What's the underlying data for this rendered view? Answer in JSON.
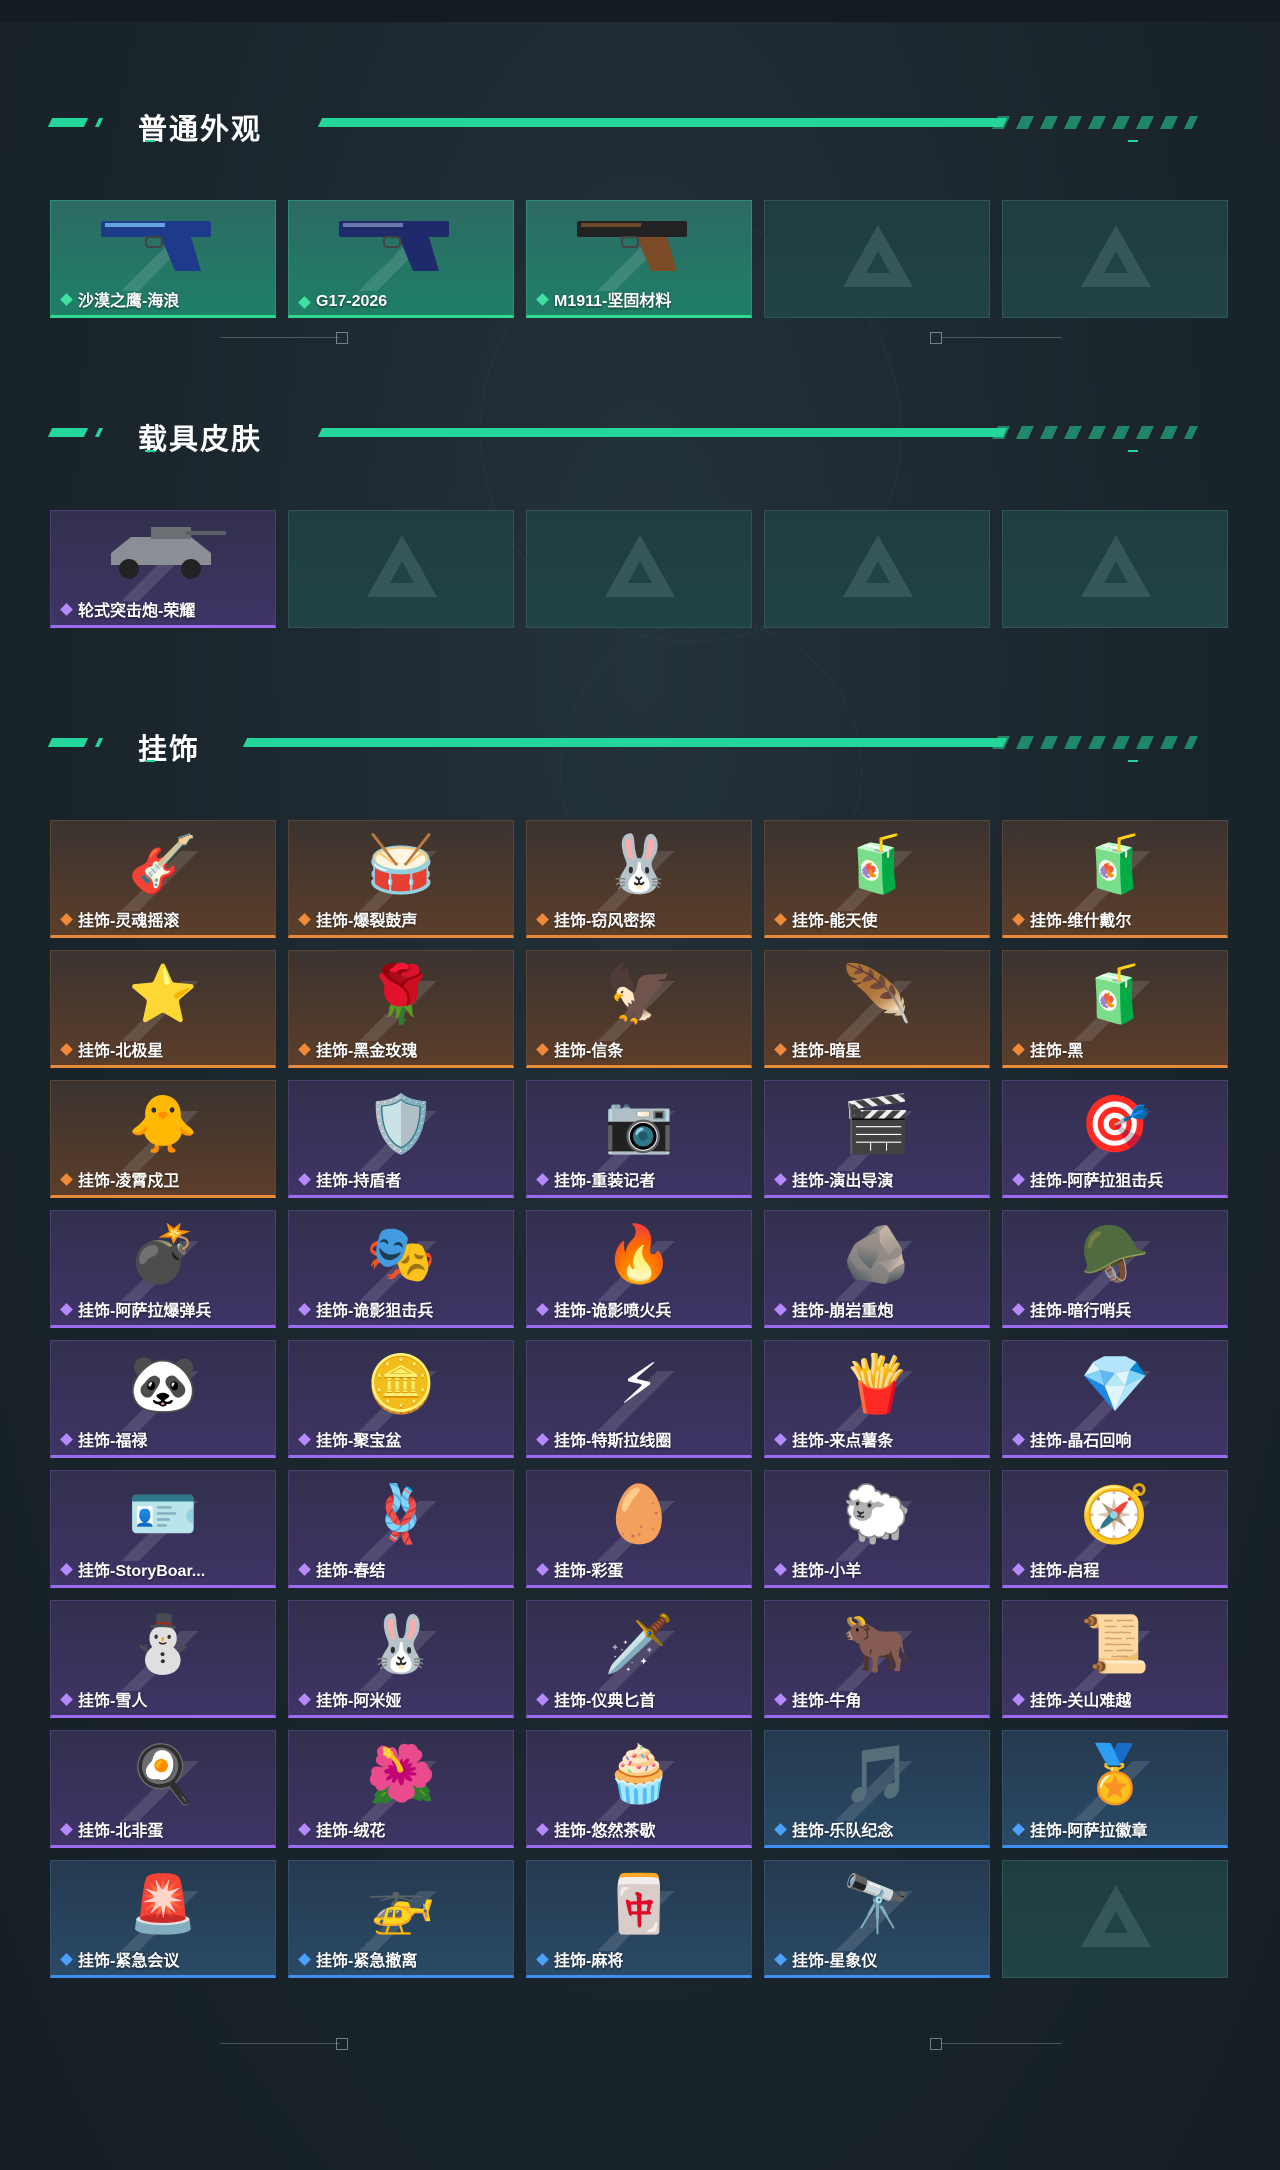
{
  "sections": [
    {
      "title": "普通外观",
      "items": [
        {
          "label": "沙漠之鹰-海浪",
          "rarity": "green",
          "icon": "pistol-icon"
        },
        {
          "label": "G17-2026",
          "rarity": "green",
          "icon": "pistol-icon"
        },
        {
          "label": "M1911-坚固材料",
          "rarity": "green",
          "icon": "pistol-icon"
        },
        {
          "label": "",
          "rarity": "empty"
        },
        {
          "label": "",
          "rarity": "empty"
        }
      ]
    },
    {
      "title": "载具皮肤",
      "items": [
        {
          "label": "轮式突击炮-荣耀",
          "rarity": "purple",
          "icon": "vehicle-icon"
        },
        {
          "label": "",
          "rarity": "empty"
        },
        {
          "label": "",
          "rarity": "empty"
        },
        {
          "label": "",
          "rarity": "empty"
        },
        {
          "label": "",
          "rarity": "empty"
        }
      ]
    },
    {
      "title": "挂饰",
      "items": [
        {
          "label": "挂饰-灵魂摇滚",
          "rarity": "orange",
          "icon": "🎸"
        },
        {
          "label": "挂饰-爆裂鼓声",
          "rarity": "orange",
          "icon": "🥁"
        },
        {
          "label": "挂饰-窃风密探",
          "rarity": "orange",
          "icon": "🐰"
        },
        {
          "label": "挂饰-能天使",
          "rarity": "orange",
          "icon": "🧃"
        },
        {
          "label": "挂饰-维什戴尔",
          "rarity": "orange",
          "icon": "🧃"
        },
        {
          "label": "挂饰-北极星",
          "rarity": "orange",
          "icon": "⭐"
        },
        {
          "label": "挂饰-黑金玫瑰",
          "rarity": "orange",
          "icon": "🌹"
        },
        {
          "label": "挂饰-信条",
          "rarity": "orange",
          "icon": "🦅"
        },
        {
          "label": "挂饰-暗星",
          "rarity": "orange",
          "icon": "🪶"
        },
        {
          "label": "挂饰-黑",
          "rarity": "orange",
          "icon": "🧃"
        },
        {
          "label": "挂饰-凌霄戍卫",
          "rarity": "orange",
          "icon": "🐥"
        },
        {
          "label": "挂饰-持盾者",
          "rarity": "purple",
          "icon": "🛡️"
        },
        {
          "label": "挂饰-重装记者",
          "rarity": "purple",
          "icon": "📷"
        },
        {
          "label": "挂饰-演出导演",
          "rarity": "purple",
          "icon": "🎬"
        },
        {
          "label": "挂饰-阿萨拉狙击兵",
          "rarity": "purple",
          "icon": "🎯"
        },
        {
          "label": "挂饰-阿萨拉爆弹兵",
          "rarity": "purple",
          "icon": "💣"
        },
        {
          "label": "挂饰-诡影狙击兵",
          "rarity": "purple",
          "icon": "🎭"
        },
        {
          "label": "挂饰-诡影喷火兵",
          "rarity": "purple",
          "icon": "🔥"
        },
        {
          "label": "挂饰-崩岩重炮",
          "rarity": "purple",
          "icon": "🪨"
        },
        {
          "label": "挂饰-暗行哨兵",
          "rarity": "purple",
          "icon": "🪖"
        },
        {
          "label": "挂饰-福禄",
          "rarity": "purple",
          "icon": "🐼"
        },
        {
          "label": "挂饰-聚宝盆",
          "rarity": "purple",
          "icon": "🪙"
        },
        {
          "label": "挂饰-特斯拉线圈",
          "rarity": "purple",
          "icon": "⚡"
        },
        {
          "label": "挂饰-来点薯条",
          "rarity": "purple",
          "icon": "🍟"
        },
        {
          "label": "挂饰-晶石回响",
          "rarity": "purple",
          "icon": "💎"
        },
        {
          "label": "挂饰-StoryBoar...",
          "rarity": "purple",
          "icon": "🪪"
        },
        {
          "label": "挂饰-春结",
          "rarity": "purple",
          "icon": "🪢"
        },
        {
          "label": "挂饰-彩蛋",
          "rarity": "purple",
          "icon": "🥚"
        },
        {
          "label": "挂饰-小羊",
          "rarity": "purple",
          "icon": "🐑"
        },
        {
          "label": "挂饰-启程",
          "rarity": "purple",
          "icon": "🧭"
        },
        {
          "label": "挂饰-雪人",
          "rarity": "purple",
          "icon": "⛄"
        },
        {
          "label": "挂饰-阿米娅",
          "rarity": "purple",
          "icon": "🐰"
        },
        {
          "label": "挂饰-仪典匕首",
          "rarity": "purple",
          "icon": "🗡️"
        },
        {
          "label": "挂饰-牛角",
          "rarity": "purple",
          "icon": "🐂"
        },
        {
          "label": "挂饰-关山难越",
          "rarity": "purple",
          "icon": "📜"
        },
        {
          "label": "挂饰-北非蛋",
          "rarity": "purple",
          "icon": "🍳"
        },
        {
          "label": "挂饰-绒花",
          "rarity": "purple",
          "icon": "🌺"
        },
        {
          "label": "挂饰-悠然茶歇",
          "rarity": "purple",
          "icon": "🧁"
        },
        {
          "label": "挂饰-乐队纪念",
          "rarity": "blue",
          "icon": "🎵"
        },
        {
          "label": "挂饰-阿萨拉徽章",
          "rarity": "blue",
          "icon": "🏅"
        },
        {
          "label": "挂饰-紧急会议",
          "rarity": "blue",
          "icon": "🚨"
        },
        {
          "label": "挂饰-紧急撤离",
          "rarity": "blue",
          "icon": "🚁"
        },
        {
          "label": "挂饰-麻将",
          "rarity": "blue",
          "icon": "🀄"
        },
        {
          "label": "挂饰-星象仪",
          "rarity": "blue",
          "icon": "🔭"
        },
        {
          "label": "",
          "rarity": "empty"
        }
      ]
    }
  ],
  "colors": {
    "accent": "#25d69a",
    "green": "#2fd98f",
    "orange": "#e88a3c",
    "purple": "#9b6cf2",
    "blue": "#3f8ef0"
  }
}
